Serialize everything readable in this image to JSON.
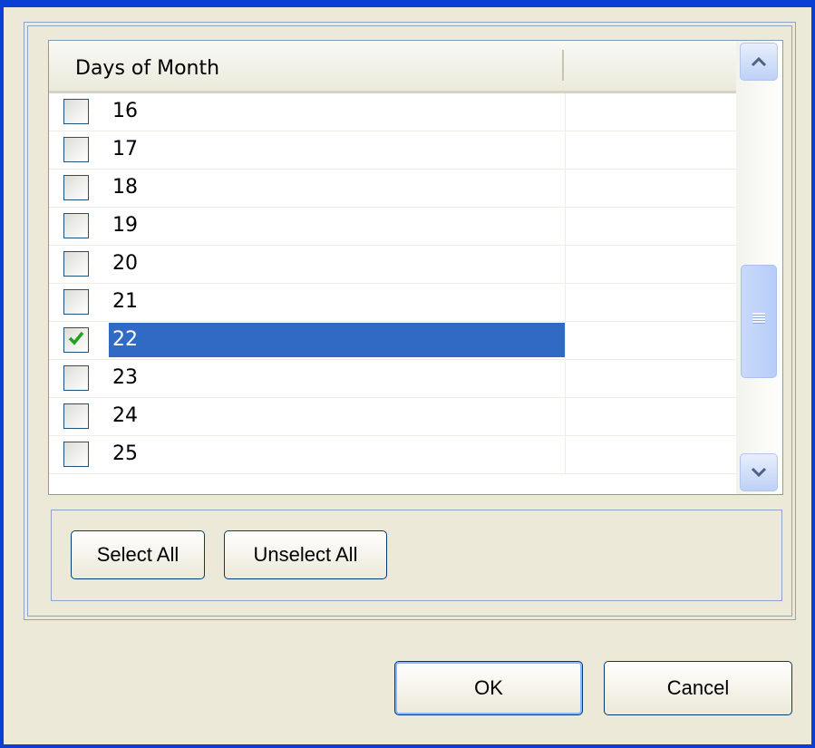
{
  "listview": {
    "column_header": "Days of Month",
    "rows": [
      {
        "label": "16",
        "checked": false,
        "selected": false
      },
      {
        "label": "17",
        "checked": false,
        "selected": false
      },
      {
        "label": "18",
        "checked": false,
        "selected": false
      },
      {
        "label": "19",
        "checked": false,
        "selected": false
      },
      {
        "label": "20",
        "checked": false,
        "selected": false
      },
      {
        "label": "21",
        "checked": false,
        "selected": false
      },
      {
        "label": "22",
        "checked": true,
        "selected": true
      },
      {
        "label": "23",
        "checked": false,
        "selected": false
      },
      {
        "label": "24",
        "checked": false,
        "selected": false
      },
      {
        "label": "25",
        "checked": false,
        "selected": false
      }
    ]
  },
  "actions": {
    "select_all": "Select All",
    "unselect_all": "Unselect All"
  },
  "dialog": {
    "ok": "OK",
    "cancel": "Cancel"
  },
  "icons": {
    "scroll_up": "chevron-up-icon",
    "scroll_down": "chevron-down-icon",
    "check": "checkmark-icon"
  },
  "colors": {
    "selection": "#316ac5",
    "window_frame": "#0a3fd6",
    "background": "#ece9d8"
  }
}
